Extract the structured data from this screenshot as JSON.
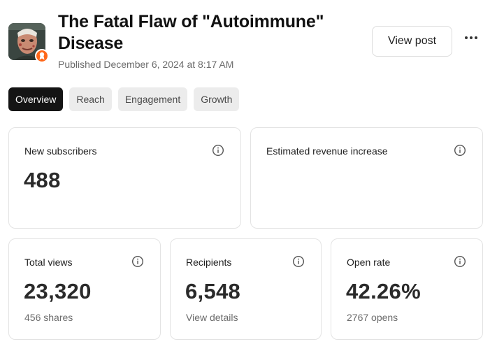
{
  "post": {
    "title": "The Fatal Flaw of \"Autoimmune\" Disease",
    "published": "Published December 6, 2024 at 8:17 AM",
    "view_post_label": "View post"
  },
  "tabs": [
    {
      "label": "Overview",
      "active": true
    },
    {
      "label": "Reach",
      "active": false
    },
    {
      "label": "Engagement",
      "active": false
    },
    {
      "label": "Growth",
      "active": false
    }
  ],
  "cards": {
    "new_subscribers": {
      "label": "New subscribers",
      "value": "488"
    },
    "estimated_revenue": {
      "label": "Estimated revenue increase",
      "value": ""
    },
    "total_views": {
      "label": "Total views",
      "value": "23,320",
      "sub": "456 shares"
    },
    "recipients": {
      "label": "Recipients",
      "value": "6,548",
      "sub": "View details"
    },
    "open_rate": {
      "label": "Open rate",
      "value": "42.26%",
      "sub": "2767 opens"
    }
  },
  "icons": {
    "info": "info-circle-icon",
    "more": "more-horizontal-icon",
    "badge": "bestseller-badge-icon"
  },
  "colors": {
    "accent": "#ff6719",
    "active_tab_bg": "#141414",
    "tab_bg": "#ececec",
    "card_border": "#e3e3e3"
  }
}
